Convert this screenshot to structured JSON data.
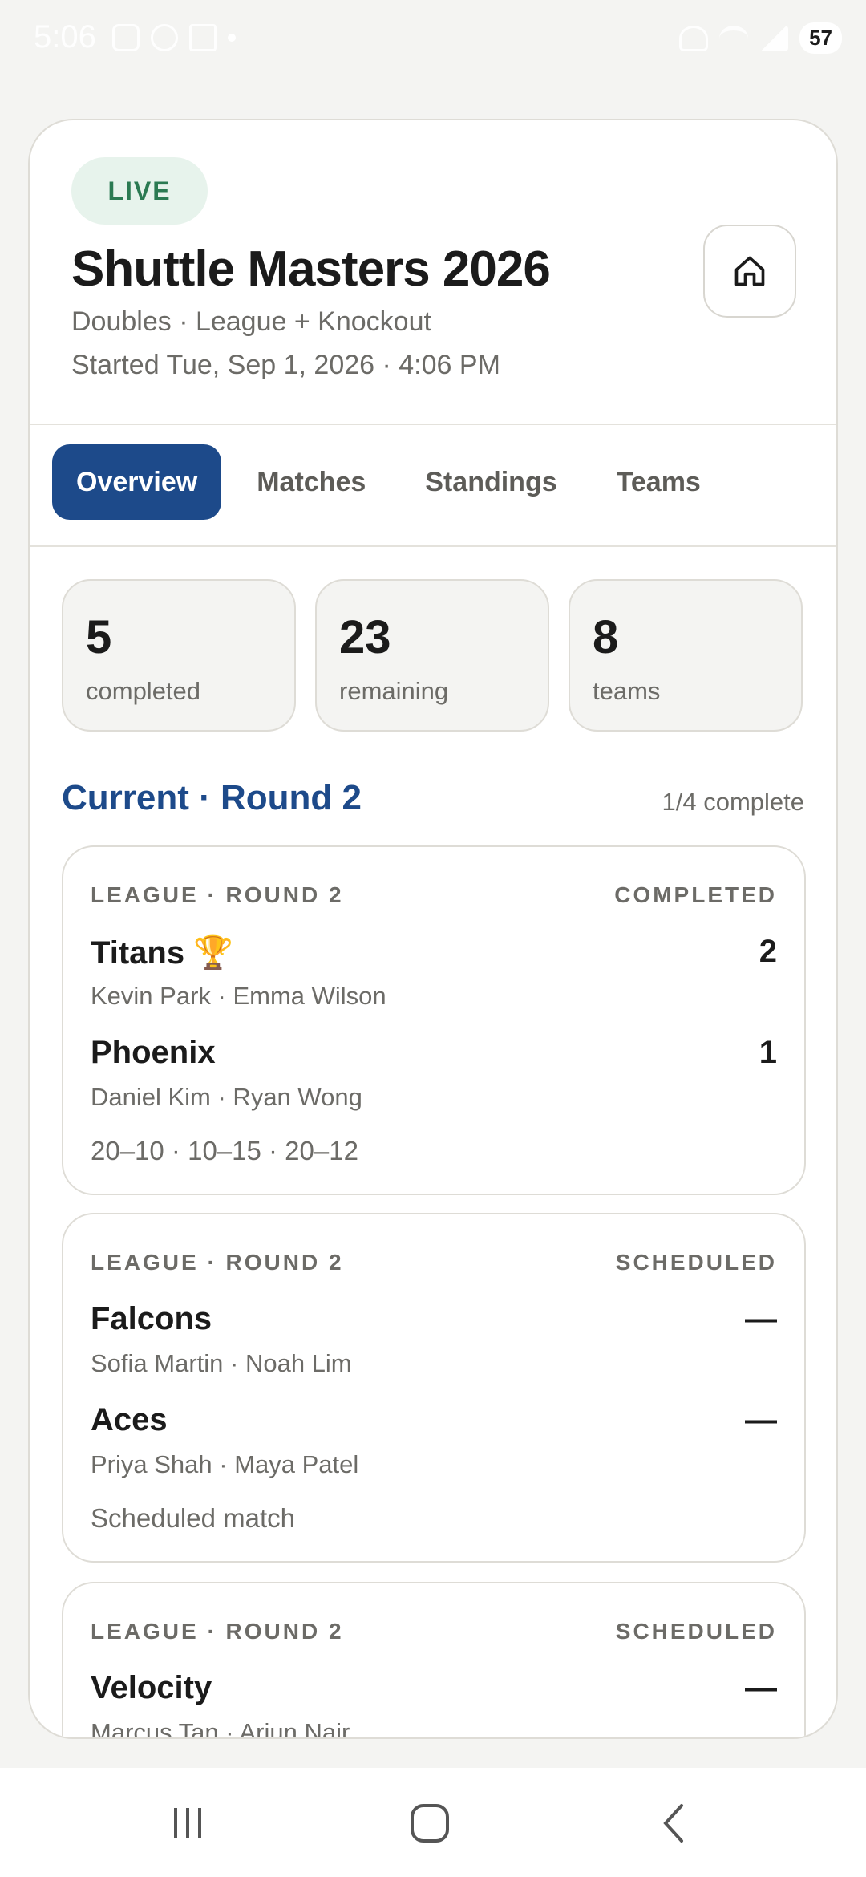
{
  "status_bar": {
    "time": "5:06",
    "battery": "57"
  },
  "header": {
    "live_label": "LIVE",
    "title": "Shuttle Masters 2026",
    "subtitle": "Doubles · League + Knockout",
    "started": "Started Tue, Sep 1, 2026 · 4:06 PM",
    "home_icon": "home-icon"
  },
  "tabs": [
    {
      "label": "Overview",
      "active": true
    },
    {
      "label": "Matches",
      "active": false
    },
    {
      "label": "Standings",
      "active": false
    },
    {
      "label": "Teams",
      "active": false
    }
  ],
  "stats": [
    {
      "value": "5",
      "label": "completed"
    },
    {
      "value": "23",
      "label": "remaining"
    },
    {
      "value": "8",
      "label": "teams"
    }
  ],
  "section": {
    "title": "Current · Round 2",
    "meta": "1/4 complete"
  },
  "matches": [
    {
      "header": "LEAGUE · ROUND 2",
      "status": "COMPLETED",
      "team1": {
        "name": "Titans 🏆",
        "players": "Kevin Park · Emma Wilson",
        "score": "2"
      },
      "team2": {
        "name": "Phoenix",
        "players": "Daniel Kim · Ryan Wong",
        "score": "1"
      },
      "footer": "20–10 · 10–15 · 20–12"
    },
    {
      "header": "LEAGUE · ROUND 2",
      "status": "SCHEDULED",
      "team1": {
        "name": "Falcons",
        "players": "Sofia Martin · Noah Lim",
        "score": "—"
      },
      "team2": {
        "name": "Aces",
        "players": "Priya Shah · Maya Patel",
        "score": "—"
      },
      "footer": "Scheduled match"
    },
    {
      "header": "LEAGUE · ROUND 2",
      "status": "SCHEDULED",
      "team1": {
        "name": "Velocity",
        "players": "Marcus Tan · Arjun Nair",
        "score": "—"
      }
    }
  ],
  "colors": {
    "accent": "#1d4a8a",
    "live": "#2b7a52",
    "live_bg": "#e7f3ec"
  }
}
